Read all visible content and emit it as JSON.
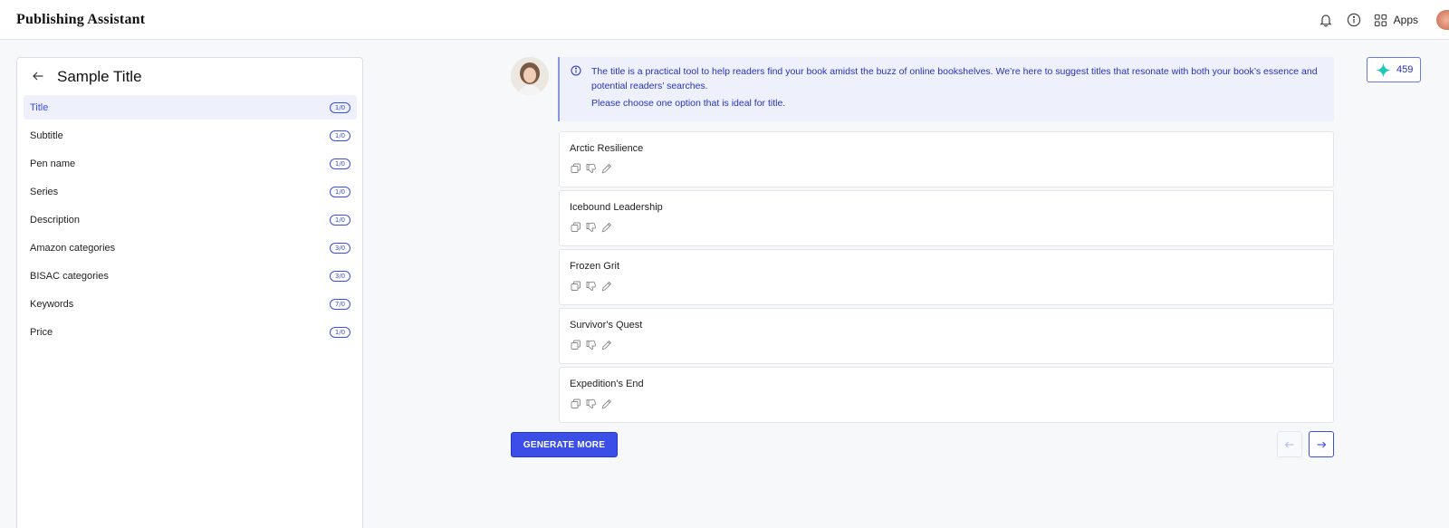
{
  "app": {
    "title": "Publishing Assistant"
  },
  "topbar": {
    "notifications_icon": "bell-icon",
    "info_icon": "info-icon",
    "apps_label": "Apps"
  },
  "sidebar": {
    "title": "Sample Title",
    "items": [
      {
        "label": "Title",
        "count": "1/0",
        "active": true
      },
      {
        "label": "Subtitle",
        "count": "1/0"
      },
      {
        "label": "Pen name",
        "count": "1/0"
      },
      {
        "label": "Series",
        "count": "1/0"
      },
      {
        "label": "Description",
        "count": "1/0"
      },
      {
        "label": "Amazon categories",
        "count": "3/0"
      },
      {
        "label": "BISAC categories",
        "count": "3/0"
      },
      {
        "label": "Keywords",
        "count": "7/0"
      },
      {
        "label": "Price",
        "count": "1/0"
      }
    ]
  },
  "info": {
    "text": "The title is a practical tool to help readers find your book amidst the buzz of online bookshelves. We’re here to suggest titles that resonate with both your book’s essence and potential readers’ searches.",
    "instruction": "Please choose one option that is ideal for title."
  },
  "options": [
    {
      "title": "Arctic Resilience"
    },
    {
      "title": "Icebound Leadership"
    },
    {
      "title": "Frozen Grit"
    },
    {
      "title": "Survivor's Quest"
    },
    {
      "title": "Expedition's End"
    }
  ],
  "actions": {
    "generate_more": "GENERATE MORE"
  },
  "credits": {
    "value": "459"
  },
  "colors": {
    "accent": "#3b4ee8",
    "info_bg": "#eef0fc",
    "info_text": "#2533b8"
  }
}
